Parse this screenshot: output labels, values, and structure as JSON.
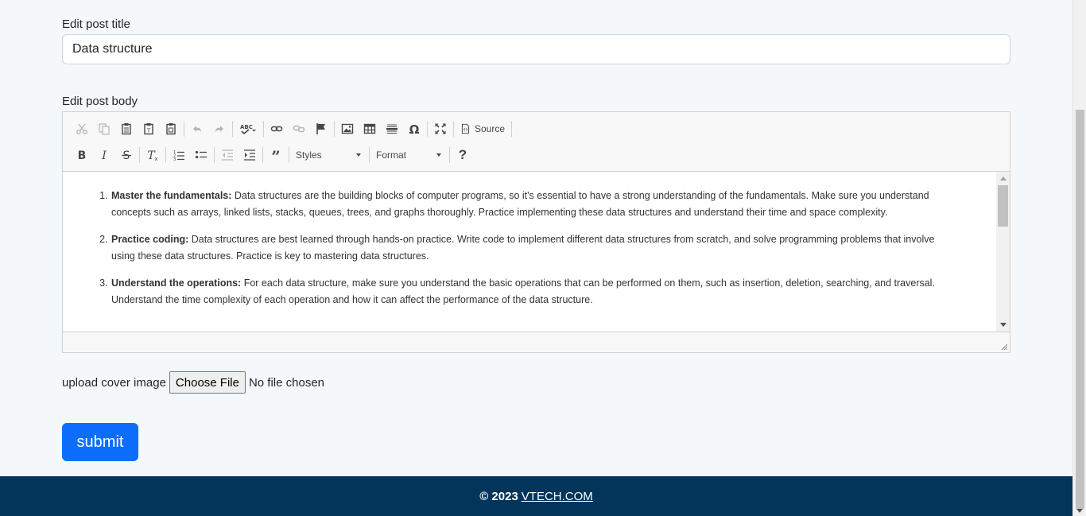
{
  "form": {
    "title_label": "Edit post title",
    "title_value": "Data structure",
    "body_label": "Edit post body",
    "upload_label": "upload cover image",
    "file_button": "Choose File",
    "file_status": "No file chosen",
    "submit_label": "submit"
  },
  "toolbar": {
    "row1": [
      {
        "name": "cut-icon",
        "enabled": false
      },
      {
        "name": "copy-icon",
        "enabled": false
      },
      {
        "name": "paste-icon",
        "enabled": true
      },
      {
        "name": "paste-text-icon",
        "enabled": true
      },
      {
        "name": "paste-word-icon",
        "enabled": true
      },
      {
        "name": "undo-icon",
        "enabled": false
      },
      {
        "name": "redo-icon",
        "enabled": false
      },
      {
        "name": "spellcheck-icon",
        "enabled": true
      },
      {
        "name": "link-icon",
        "enabled": true
      },
      {
        "name": "unlink-icon",
        "enabled": false
      },
      {
        "name": "anchor-icon",
        "enabled": true
      },
      {
        "name": "image-icon",
        "enabled": true
      },
      {
        "name": "table-icon",
        "enabled": true
      },
      {
        "name": "horizontal-line-icon",
        "enabled": true
      },
      {
        "name": "special-char-icon",
        "enabled": true
      },
      {
        "name": "maximize-icon",
        "enabled": true
      }
    ],
    "source_label": "Source",
    "styles_label": "Styles",
    "format_label": "Format",
    "help_label": "?"
  },
  "content": {
    "items": [
      {
        "heading": "Master the fundamentals:",
        "text": " Data structures are the building blocks of computer programs, so it's essential to have a strong understanding of the fundamentals. Make sure you understand concepts such as arrays, linked lists, stacks, queues, trees, and graphs thoroughly. Practice implementing these data structures and understand their time and space complexity."
      },
      {
        "heading": "Practice coding:",
        "text": " Data structures are best learned through hands-on practice. Write code to implement different data structures from scratch, and solve programming problems that involve using these data structures. Practice is key to mastering data structures."
      },
      {
        "heading": "Understand the operations:",
        "text": " For each data structure, make sure you understand the basic operations that can be performed on them, such as insertion, deletion, searching, and traversal. Understand the time complexity of each operation and how it can affect the performance of the data structure."
      }
    ]
  },
  "footer": {
    "copyright": "© 2023",
    "link_text": "VTECH.COM"
  },
  "colors": {
    "primary": "#0d6efd",
    "footer_bg": "#03345a",
    "page_bg": "#f5f8fb"
  }
}
